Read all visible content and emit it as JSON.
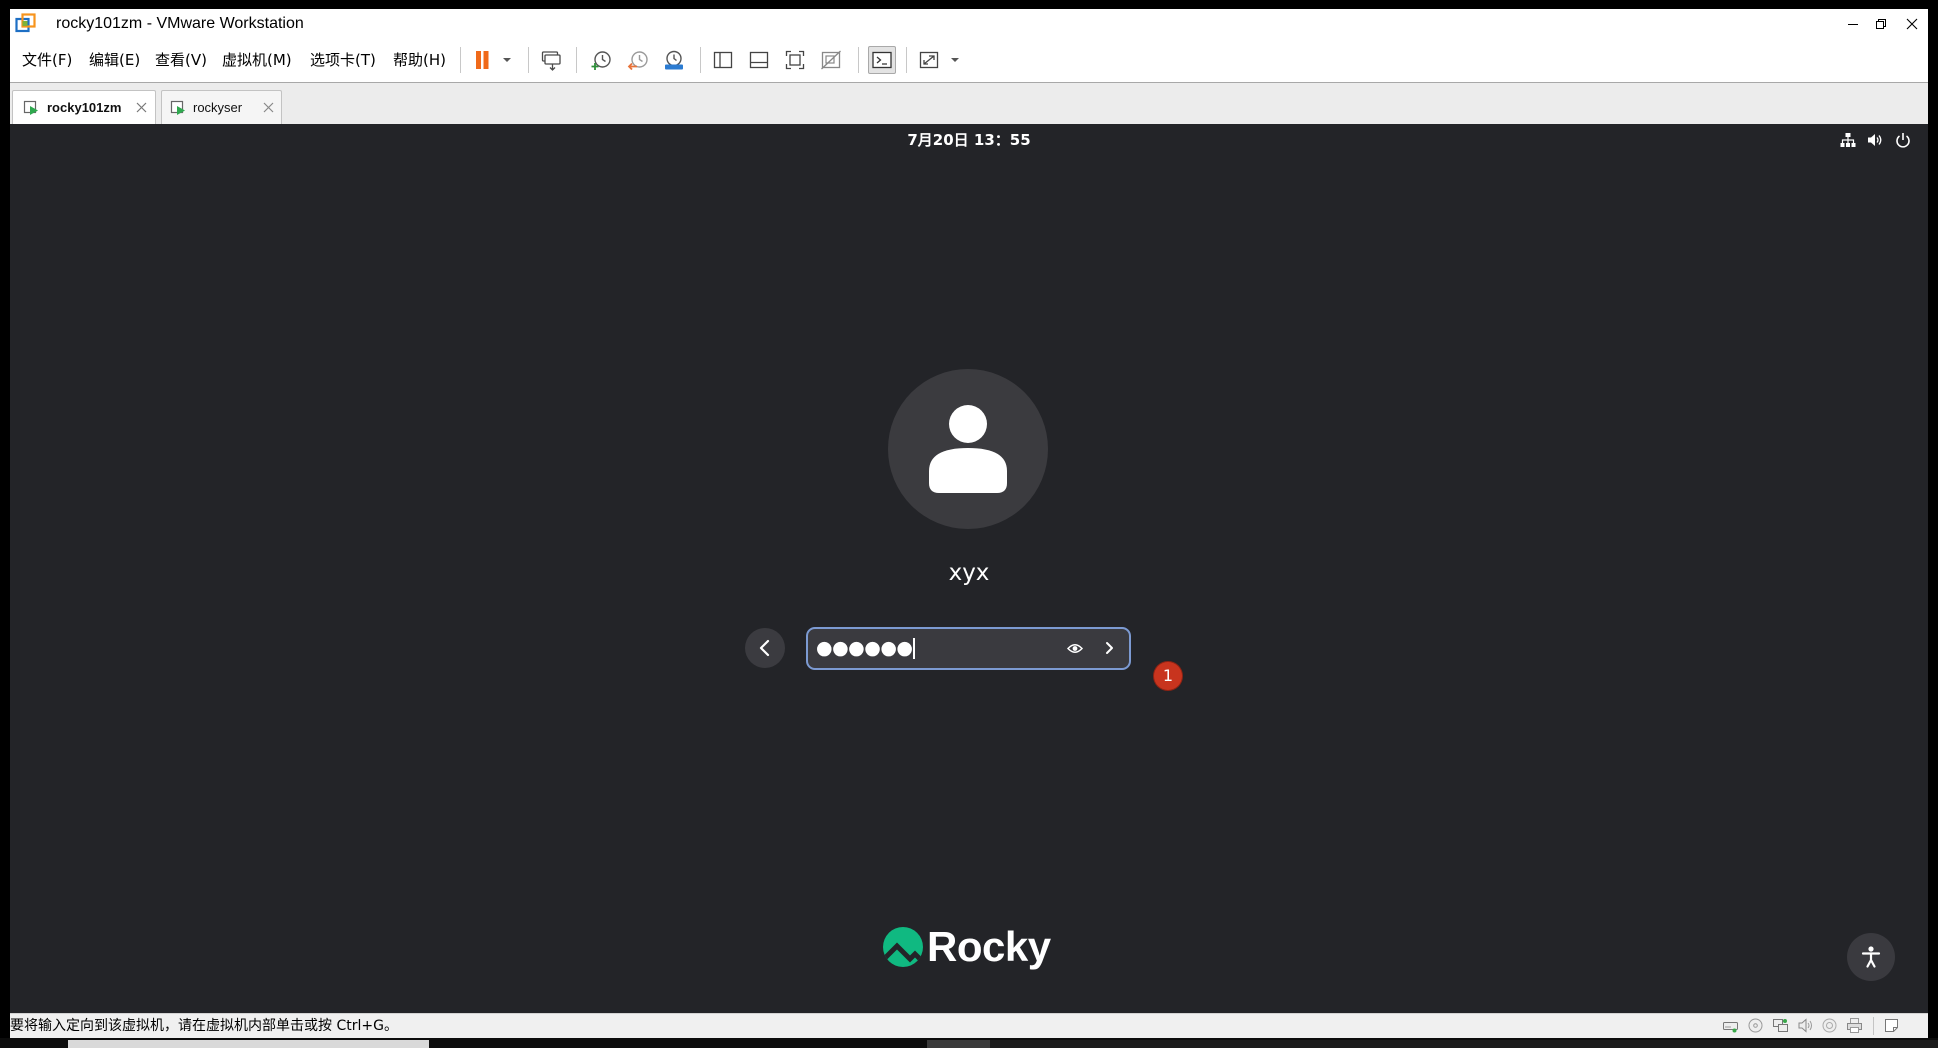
{
  "window": {
    "title": "rocky101zm - VMware Workstation",
    "controls": [
      "minimize-icon",
      "restore-icon",
      "close-icon"
    ]
  },
  "menu": {
    "items": [
      "文件(F)",
      "编辑(E)",
      "查看(V)",
      "虚拟机(M)",
      "选项卡(T)",
      "帮助(H)"
    ]
  },
  "toolbar": {
    "icons": [
      "pause-icon",
      "dropdown-arrow-icon",
      "send-ctrl-alt-del-icon",
      "take-snapshot-icon",
      "revert-snapshot-icon",
      "snapshot-manager-icon",
      "show-library-icon",
      "show-thumbnail-bar-icon",
      "full-screen-icon",
      "unity-icon",
      "console-view-icon",
      "stretch-guest-icon",
      "dropdown-arrow-icon"
    ]
  },
  "tabs": [
    {
      "label": "rocky101zm",
      "active": true
    },
    {
      "label": "rockyser",
      "active": false
    }
  ],
  "guest": {
    "clock": "7月20日 13：55",
    "username": "xyx",
    "password_masked": "●●●●●●",
    "notification_badge": "1",
    "brand": "Rocky",
    "top_bar_icons": [
      "network-icon",
      "volume-icon",
      "power-icon"
    ]
  },
  "status_bar": {
    "message": "要将输入定向到该虚拟机，请在虚拟机内部单击或按 Ctrl+G。",
    "device_icons": [
      "hard-disk-icon",
      "cd-dvd-icon",
      "network-adapter-icon",
      "sound-card-icon",
      "usb-controller-icon",
      "printer-icon",
      "message-log-icon"
    ]
  },
  "colors": {
    "guest_background": "#232428",
    "avatar_background": "#3b3b3f",
    "field_border": "#7c9ad2",
    "badge_red": "#c8341e",
    "rocky_green": "#10b981",
    "pause_orange": "#f06a1a"
  }
}
